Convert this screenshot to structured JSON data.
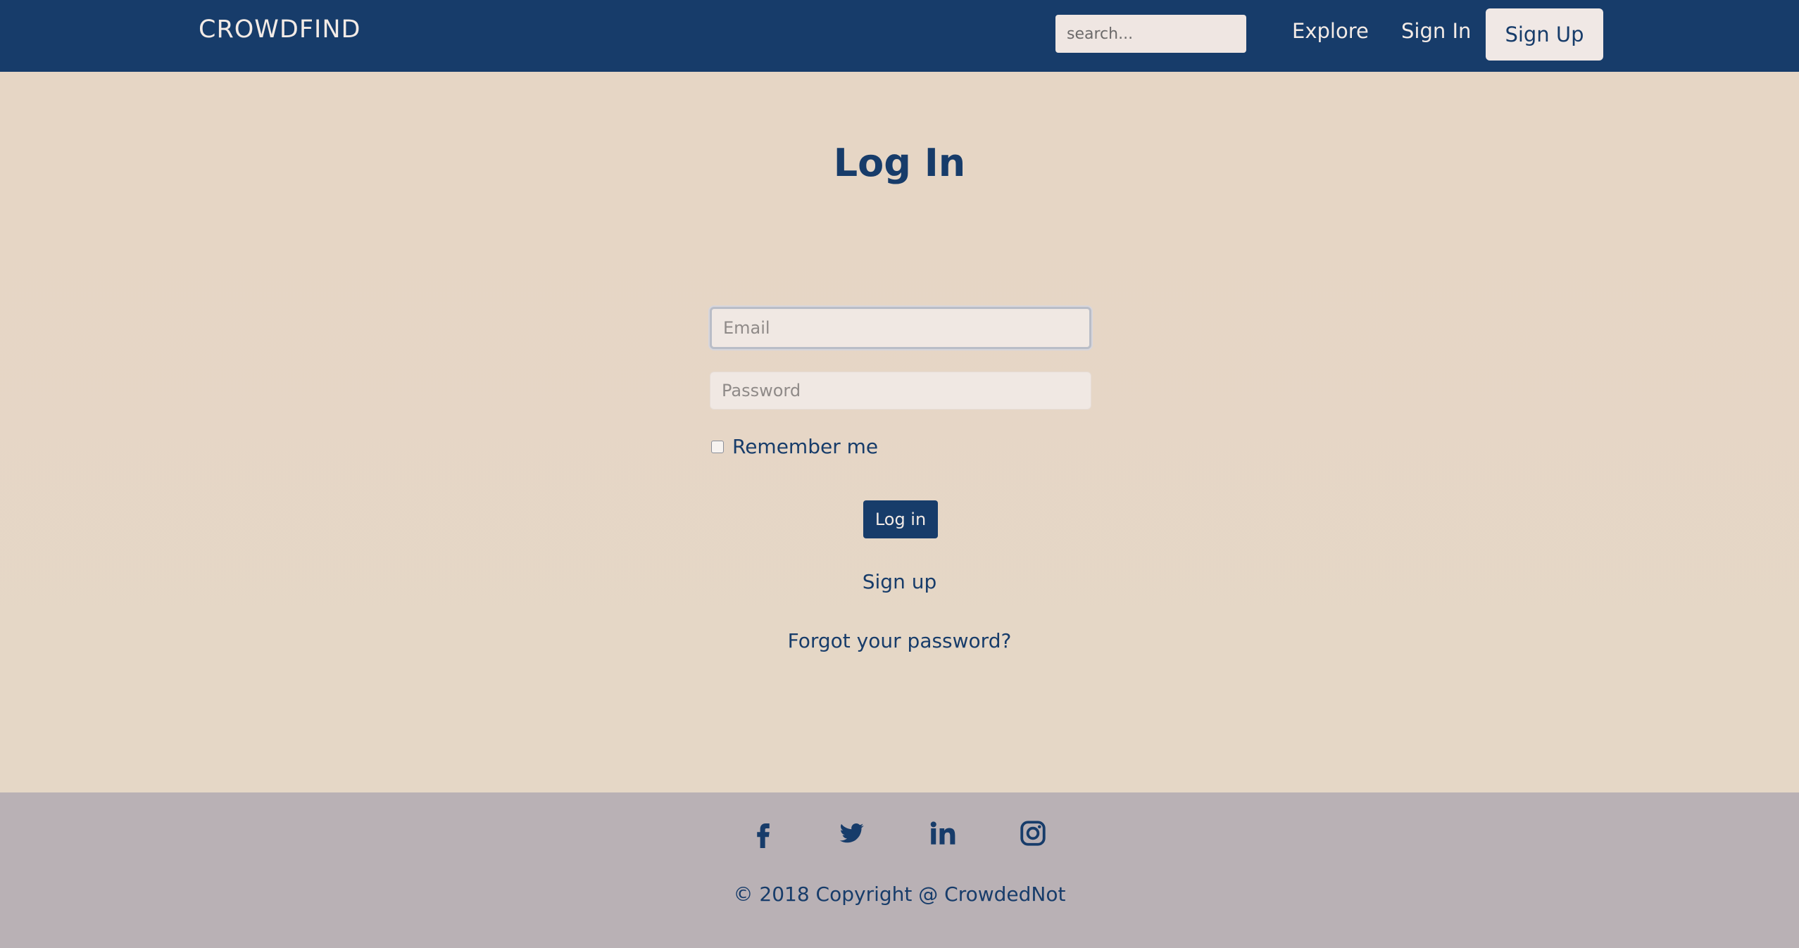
{
  "colors": {
    "primary": "#173c6a",
    "page_bg": "#e5d6c6",
    "footer_bg": "#b9b1b5",
    "input_bg": "#f0e8e3"
  },
  "navbar": {
    "brand": "CROWDFIND",
    "search_placeholder": "search...",
    "links": {
      "explore": "Explore",
      "sign_in": "Sign In",
      "sign_up": "Sign Up"
    }
  },
  "login": {
    "title": "Log In",
    "email_placeholder": "Email",
    "password_placeholder": "Password",
    "remember_label": "Remember me",
    "submit_label": "Log in",
    "signup_link": "Sign up",
    "forgot_link": "Forgot your password?"
  },
  "footer": {
    "social_icons": [
      "facebook-icon",
      "twitter-icon",
      "linkedin-icon",
      "instagram-icon"
    ],
    "copyright": "© 2018 Copyright @  CrowdedNot"
  }
}
